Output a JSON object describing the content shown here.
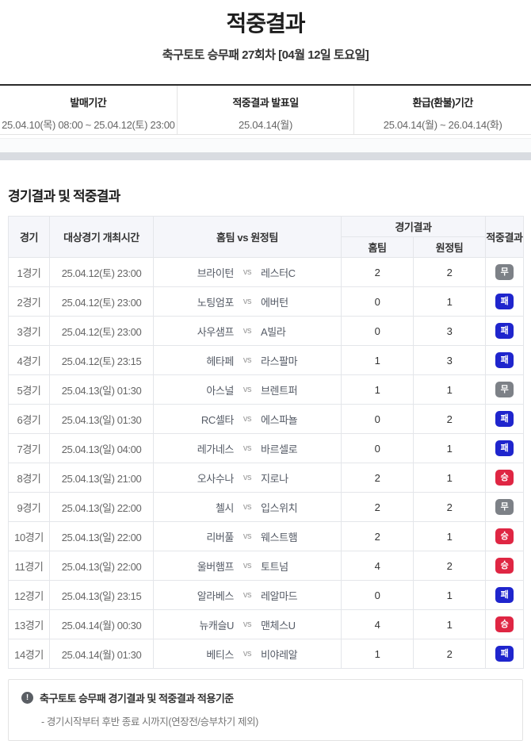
{
  "page": {
    "title": "적중결과",
    "subtitle": "축구토토 승무패 27회차 [04월 12일 토요일]"
  },
  "info_bar": {
    "items": [
      {
        "label": "발매기간",
        "value": "25.04.10(목) 08:00 ~ 25.04.12(토) 23:00"
      },
      {
        "label": "적중결과 발표일",
        "value": "25.04.14(월)"
      },
      {
        "label": "환급(환불)기간",
        "value": "25.04.14(월) ~ 26.04.14(화)"
      }
    ]
  },
  "section": {
    "title": "경기결과 및 적중결과"
  },
  "table": {
    "headers": {
      "match": "경기",
      "datetime": "대상경기 개최시간",
      "teams": "홈팀 vs 원정팀",
      "result_group": "경기결과",
      "home": "홈팀",
      "away": "원정팀",
      "hit": "적중결과"
    },
    "vs_label": "vs",
    "rows": [
      {
        "no": "1경기",
        "time": "25.04.12(토) 23:00",
        "home": "브라이턴",
        "away": "레스터C",
        "home_score": "2",
        "away_score": "2",
        "result": "무",
        "result_type": "draw"
      },
      {
        "no": "2경기",
        "time": "25.04.12(토) 23:00",
        "home": "노팅엄포",
        "away": "에버턴",
        "home_score": "0",
        "away_score": "1",
        "result": "패",
        "result_type": "lose"
      },
      {
        "no": "3경기",
        "time": "25.04.12(토) 23:00",
        "home": "사우샘프",
        "away": "A빌라",
        "home_score": "0",
        "away_score": "3",
        "result": "패",
        "result_type": "lose"
      },
      {
        "no": "4경기",
        "time": "25.04.12(토) 23:15",
        "home": "헤타페",
        "away": "라스팔마",
        "home_score": "1",
        "away_score": "3",
        "result": "패",
        "result_type": "lose"
      },
      {
        "no": "5경기",
        "time": "25.04.13(일) 01:30",
        "home": "아스널",
        "away": "브렌트퍼",
        "home_score": "1",
        "away_score": "1",
        "result": "무",
        "result_type": "draw"
      },
      {
        "no": "6경기",
        "time": "25.04.13(일) 01:30",
        "home": "RC셀타",
        "away": "에스파뇰",
        "home_score": "0",
        "away_score": "2",
        "result": "패",
        "result_type": "lose"
      },
      {
        "no": "7경기",
        "time": "25.04.13(일) 04:00",
        "home": "레가네스",
        "away": "바르셀로",
        "home_score": "0",
        "away_score": "1",
        "result": "패",
        "result_type": "lose"
      },
      {
        "no": "8경기",
        "time": "25.04.13(일) 21:00",
        "home": "오사수나",
        "away": "지로나",
        "home_score": "2",
        "away_score": "1",
        "result": "승",
        "result_type": "win"
      },
      {
        "no": "9경기",
        "time": "25.04.13(일) 22:00",
        "home": "첼시",
        "away": "입스위치",
        "home_score": "2",
        "away_score": "2",
        "result": "무",
        "result_type": "draw"
      },
      {
        "no": "10경기",
        "time": "25.04.13(일) 22:00",
        "home": "리버풀",
        "away": "웨스트햄",
        "home_score": "2",
        "away_score": "1",
        "result": "승",
        "result_type": "win"
      },
      {
        "no": "11경기",
        "time": "25.04.13(일) 22:00",
        "home": "울버햄프",
        "away": "토트넘",
        "home_score": "4",
        "away_score": "2",
        "result": "승",
        "result_type": "win"
      },
      {
        "no": "12경기",
        "time": "25.04.13(일) 23:15",
        "home": "알라베스",
        "away": "레알마드",
        "home_score": "0",
        "away_score": "1",
        "result": "패",
        "result_type": "lose"
      },
      {
        "no": "13경기",
        "time": "25.04.14(월) 00:30",
        "home": "뉴캐슬U",
        "away": "맨체스U",
        "home_score": "4",
        "away_score": "1",
        "result": "승",
        "result_type": "win"
      },
      {
        "no": "14경기",
        "time": "25.04.14(월) 01:30",
        "home": "베티스",
        "away": "비야레알",
        "home_score": "1",
        "away_score": "2",
        "result": "패",
        "result_type": "lose"
      }
    ]
  },
  "footer_note": {
    "icon": "exclamation-circle-icon",
    "icon_glyph": "!",
    "title": "축구토토 승무패 경기결과 및 적중결과 적용기준",
    "line": "- 경기시작부터 후반 종료 시까지(연장전/승부차기 제외)"
  },
  "colors": {
    "win_badge": "#df2643",
    "lose_badge": "#1f25cd",
    "draw_badge": "#7d8187",
    "header_bg": "#f5f6fa"
  }
}
